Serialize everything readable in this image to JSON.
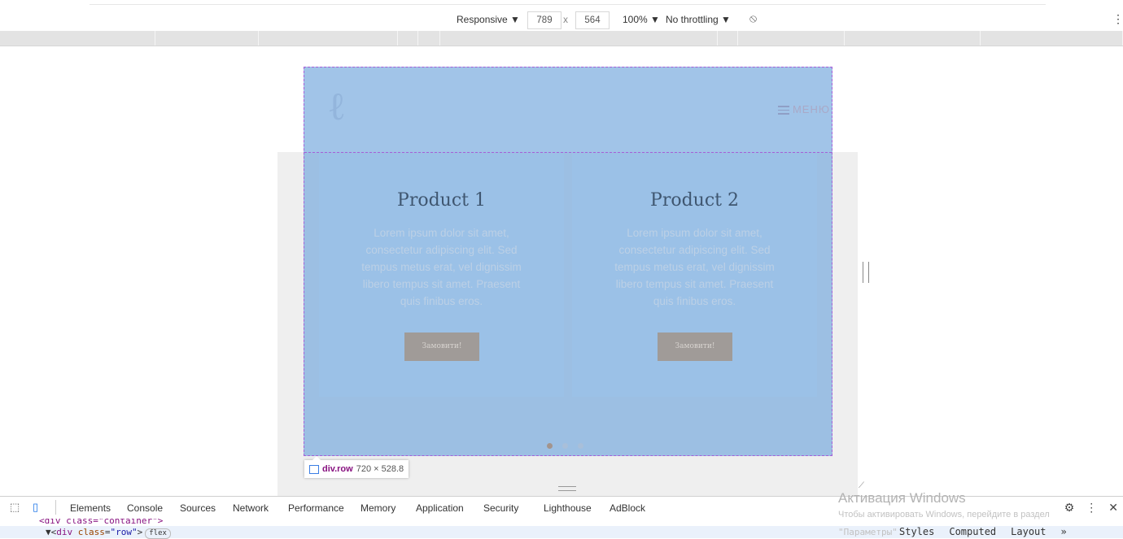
{
  "toolbar": {
    "device": "Responsive ▼",
    "width": "789",
    "times": "x",
    "height": "564",
    "zoom": "100% ▼",
    "throttling": "No throttling ▼",
    "rotate_icon": "rotate-icon",
    "more_icon": "more-vertical-icon"
  },
  "page": {
    "menu_label": "МЕНЮ",
    "products": [
      {
        "title": "Product 1",
        "description": "Lorem ipsum dolor sit amet, consectetur adipiscing elit. Sed tempus metus erat, vel dignissim libero tempus sit amet. Praesent quis finibus eros.",
        "button": "Замовити!"
      },
      {
        "title": "Product 2",
        "description": "Lorem ipsum dolor sit amet, consectetur adipiscing elit. Sed tempus metus erat, vel dignissim libero tempus sit amet. Praesent quis finibus eros.",
        "button": "Замовити!"
      }
    ],
    "carousel_dots": 3,
    "active_dot": 0
  },
  "inspector_tooltip": {
    "selector": "div.row",
    "size": "720 × 528.8"
  },
  "devtools": {
    "tabs": [
      "Elements",
      "Console",
      "Sources",
      "Network",
      "Performance",
      "Memory",
      "Application",
      "Security",
      "Lighthouse",
      "AdBlock"
    ],
    "code_line_1": "<div class=\"container\">",
    "code_line_2": {
      "prefix": "▼<",
      "tag": "div",
      "attr": "class",
      "value": "\"row\"",
      "suffix": ">",
      "badge": "flex"
    },
    "side_tabs": [
      "Styles",
      "Computed",
      "Layout",
      "»"
    ]
  },
  "windows_activation": {
    "title": "Активация Windows",
    "line1": "Чтобы активировать Windows, перейдите в раздел",
    "line2": "\"Параметры\"."
  },
  "colors": {
    "overlay": "#6fa4dc",
    "selection_border": "#a55fd8",
    "button": "#a09b98",
    "active_dot": "#a3948d"
  }
}
